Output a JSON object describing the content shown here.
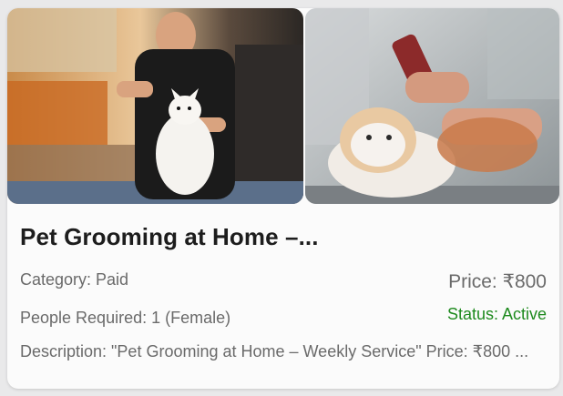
{
  "listing": {
    "title": "Pet Grooming at Home –...",
    "category": "Category: Paid",
    "people_required": "People Required: 1 (Female)",
    "price": "Price: ₹800",
    "status": "Status: Active",
    "description": "Description: \"Pet Grooming at Home – Weekly Service\" Price: ₹800 ..."
  },
  "colors": {
    "status_active": "#1e8a1e",
    "title": "#1d1d1d",
    "secondary_text": "#6a6a6a"
  }
}
